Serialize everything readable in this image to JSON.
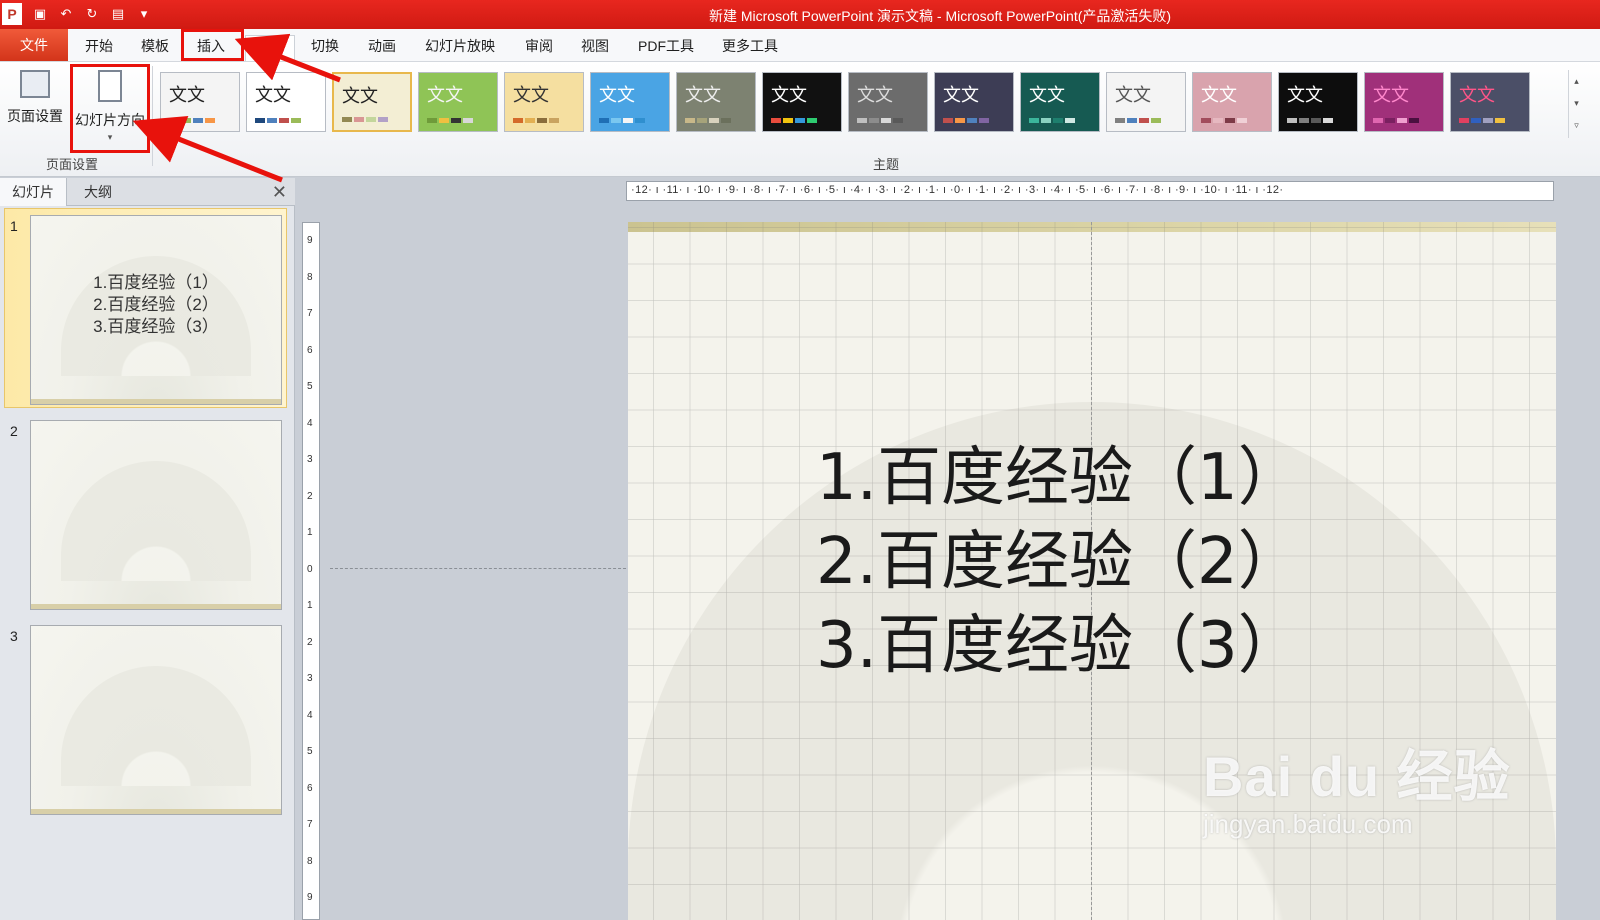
{
  "window": {
    "title": "新建 Microsoft PowerPoint 演示文稿 - Microsoft PowerPoint(产品激活失败)",
    "app_icon": "P"
  },
  "quick_access": [
    "save-icon",
    "undo-icon",
    "redo-icon",
    "new-slide-icon",
    "customize-icon"
  ],
  "tabs": {
    "file": "文件",
    "items": [
      "开始",
      "模板",
      "插入",
      "设计",
      "切换",
      "动画",
      "幻灯片放映",
      "审阅",
      "视图",
      "PDF工具",
      "更多工具"
    ],
    "active": "设计",
    "highlighted": "插入"
  },
  "ribbon": {
    "page_setup_group": "页面设置",
    "page_setup_button": "页面设置",
    "orientation_button": "幻灯片方向",
    "themes_group": "主题",
    "theme_sample_text": "文文"
  },
  "themes": [
    {
      "bg": "#f4f4f4",
      "fg": "#222",
      "sw": [
        "#c0504d",
        "#9bbb59",
        "#4f81bd",
        "#f79646"
      ]
    },
    {
      "bg": "#ffffff",
      "fg": "#222",
      "sw": [
        "#1f497d",
        "#4f81bd",
        "#c0504d",
        "#9bbb59"
      ]
    },
    {
      "bg": "#f3eed4",
      "fg": "#222",
      "sw": [
        "#938953",
        "#d99694",
        "#c3d69b",
        "#b2a1c7"
      ]
    },
    {
      "bg": "#8fc456",
      "fg": "#f5f5f5",
      "sw": [
        "#6f9b3a",
        "#f0c040",
        "#333",
        "#d8d8d8"
      ]
    },
    {
      "bg": "#f5dfa0",
      "fg": "#333",
      "sw": [
        "#d46a2a",
        "#e3b052",
        "#8a6d3b",
        "#c9a35f"
      ]
    },
    {
      "bg": "#4aa4e4",
      "fg": "#fff",
      "sw": [
        "#1f6fb5",
        "#7ac7f0",
        "#f5f5f5",
        "#2f8fcf"
      ]
    },
    {
      "bg": "#7d8271",
      "fg": "#eee",
      "sw": [
        "#c8b889",
        "#a6a37a",
        "#d8d2bd",
        "#6b705c"
      ]
    },
    {
      "bg": "#111111",
      "fg": "#fff",
      "sw": [
        "#e84c3d",
        "#f1c40f",
        "#3498db",
        "#2ecc71"
      ]
    },
    {
      "bg": "#6c6c6c",
      "fg": "#ddd",
      "sw": [
        "#bfbfbf",
        "#8c8c8c",
        "#d9d9d9",
        "#595959"
      ]
    },
    {
      "bg": "#3d3d55",
      "fg": "#fff",
      "sw": [
        "#c0504d",
        "#f79646",
        "#4f81bd",
        "#8064a2"
      ]
    },
    {
      "bg": "#165a52",
      "fg": "#fff",
      "sw": [
        "#3bb59b",
        "#8ad1c1",
        "#1e7f6e",
        "#d0e8e3"
      ]
    },
    {
      "bg": "#f4f4f4",
      "fg": "#555",
      "sw": [
        "#808080",
        "#4f81bd",
        "#c0504d",
        "#9bbb59"
      ]
    },
    {
      "bg": "#d9a3ad",
      "fg": "#fff",
      "sw": [
        "#a24c5c",
        "#e6b8c0",
        "#7d3a47",
        "#f0d0d6"
      ]
    },
    {
      "bg": "#0d0d0d",
      "fg": "#fff",
      "sw": [
        "#bfbfbf",
        "#7f7f7f",
        "#595959",
        "#d9d9d9"
      ]
    },
    {
      "bg": "#a0307a",
      "fg": "#f8c",
      "sw": [
        "#e066b0",
        "#7a2060",
        "#f0a0d0",
        "#4a1040"
      ]
    },
    {
      "bg": "#4b4f67",
      "fg": "#f58",
      "sw": [
        "#e04060",
        "#3060c0",
        "#a0a0c0",
        "#f0c040"
      ]
    }
  ],
  "panel": {
    "tab_slides": "幻灯片",
    "tab_outline": "大纲",
    "close": "✕",
    "slides": [
      {
        "number": "1",
        "lines": [
          "1.百度经验（1）",
          "2.百度经验（2）",
          "3.百度经验（3）"
        ]
      },
      {
        "number": "2",
        "lines": []
      },
      {
        "number": "3",
        "lines": []
      }
    ]
  },
  "ruler": {
    "horizontal": "·12· ı ·11· ı ·10· ı ·9· ı ·8· ı ·7· ı ·6· ı ·5· ı ·4· ı ·3· ı ·2· ı ·1· ı ·0· ı ·1· ı ·2· ı ·3· ı ·4· ı ·5· ı ·6· ı ·7· ı ·8· ı ·9· ı ·10· ı ·11· ı ·12·",
    "vertical": [
      "9",
      "8",
      "7",
      "6",
      "5",
      "4",
      "3",
      "2",
      "1",
      "0",
      "1",
      "2",
      "3",
      "4",
      "5",
      "6",
      "7",
      "8",
      "9"
    ]
  },
  "slide": {
    "lines": [
      "1.百度经验（1）",
      "2.百度经验（2）",
      "3.百度经验（3）"
    ]
  },
  "watermark": {
    "main": "Bai du 经验",
    "sub": "jingyan.baidu.com"
  },
  "annotation_color": "#e8120c"
}
